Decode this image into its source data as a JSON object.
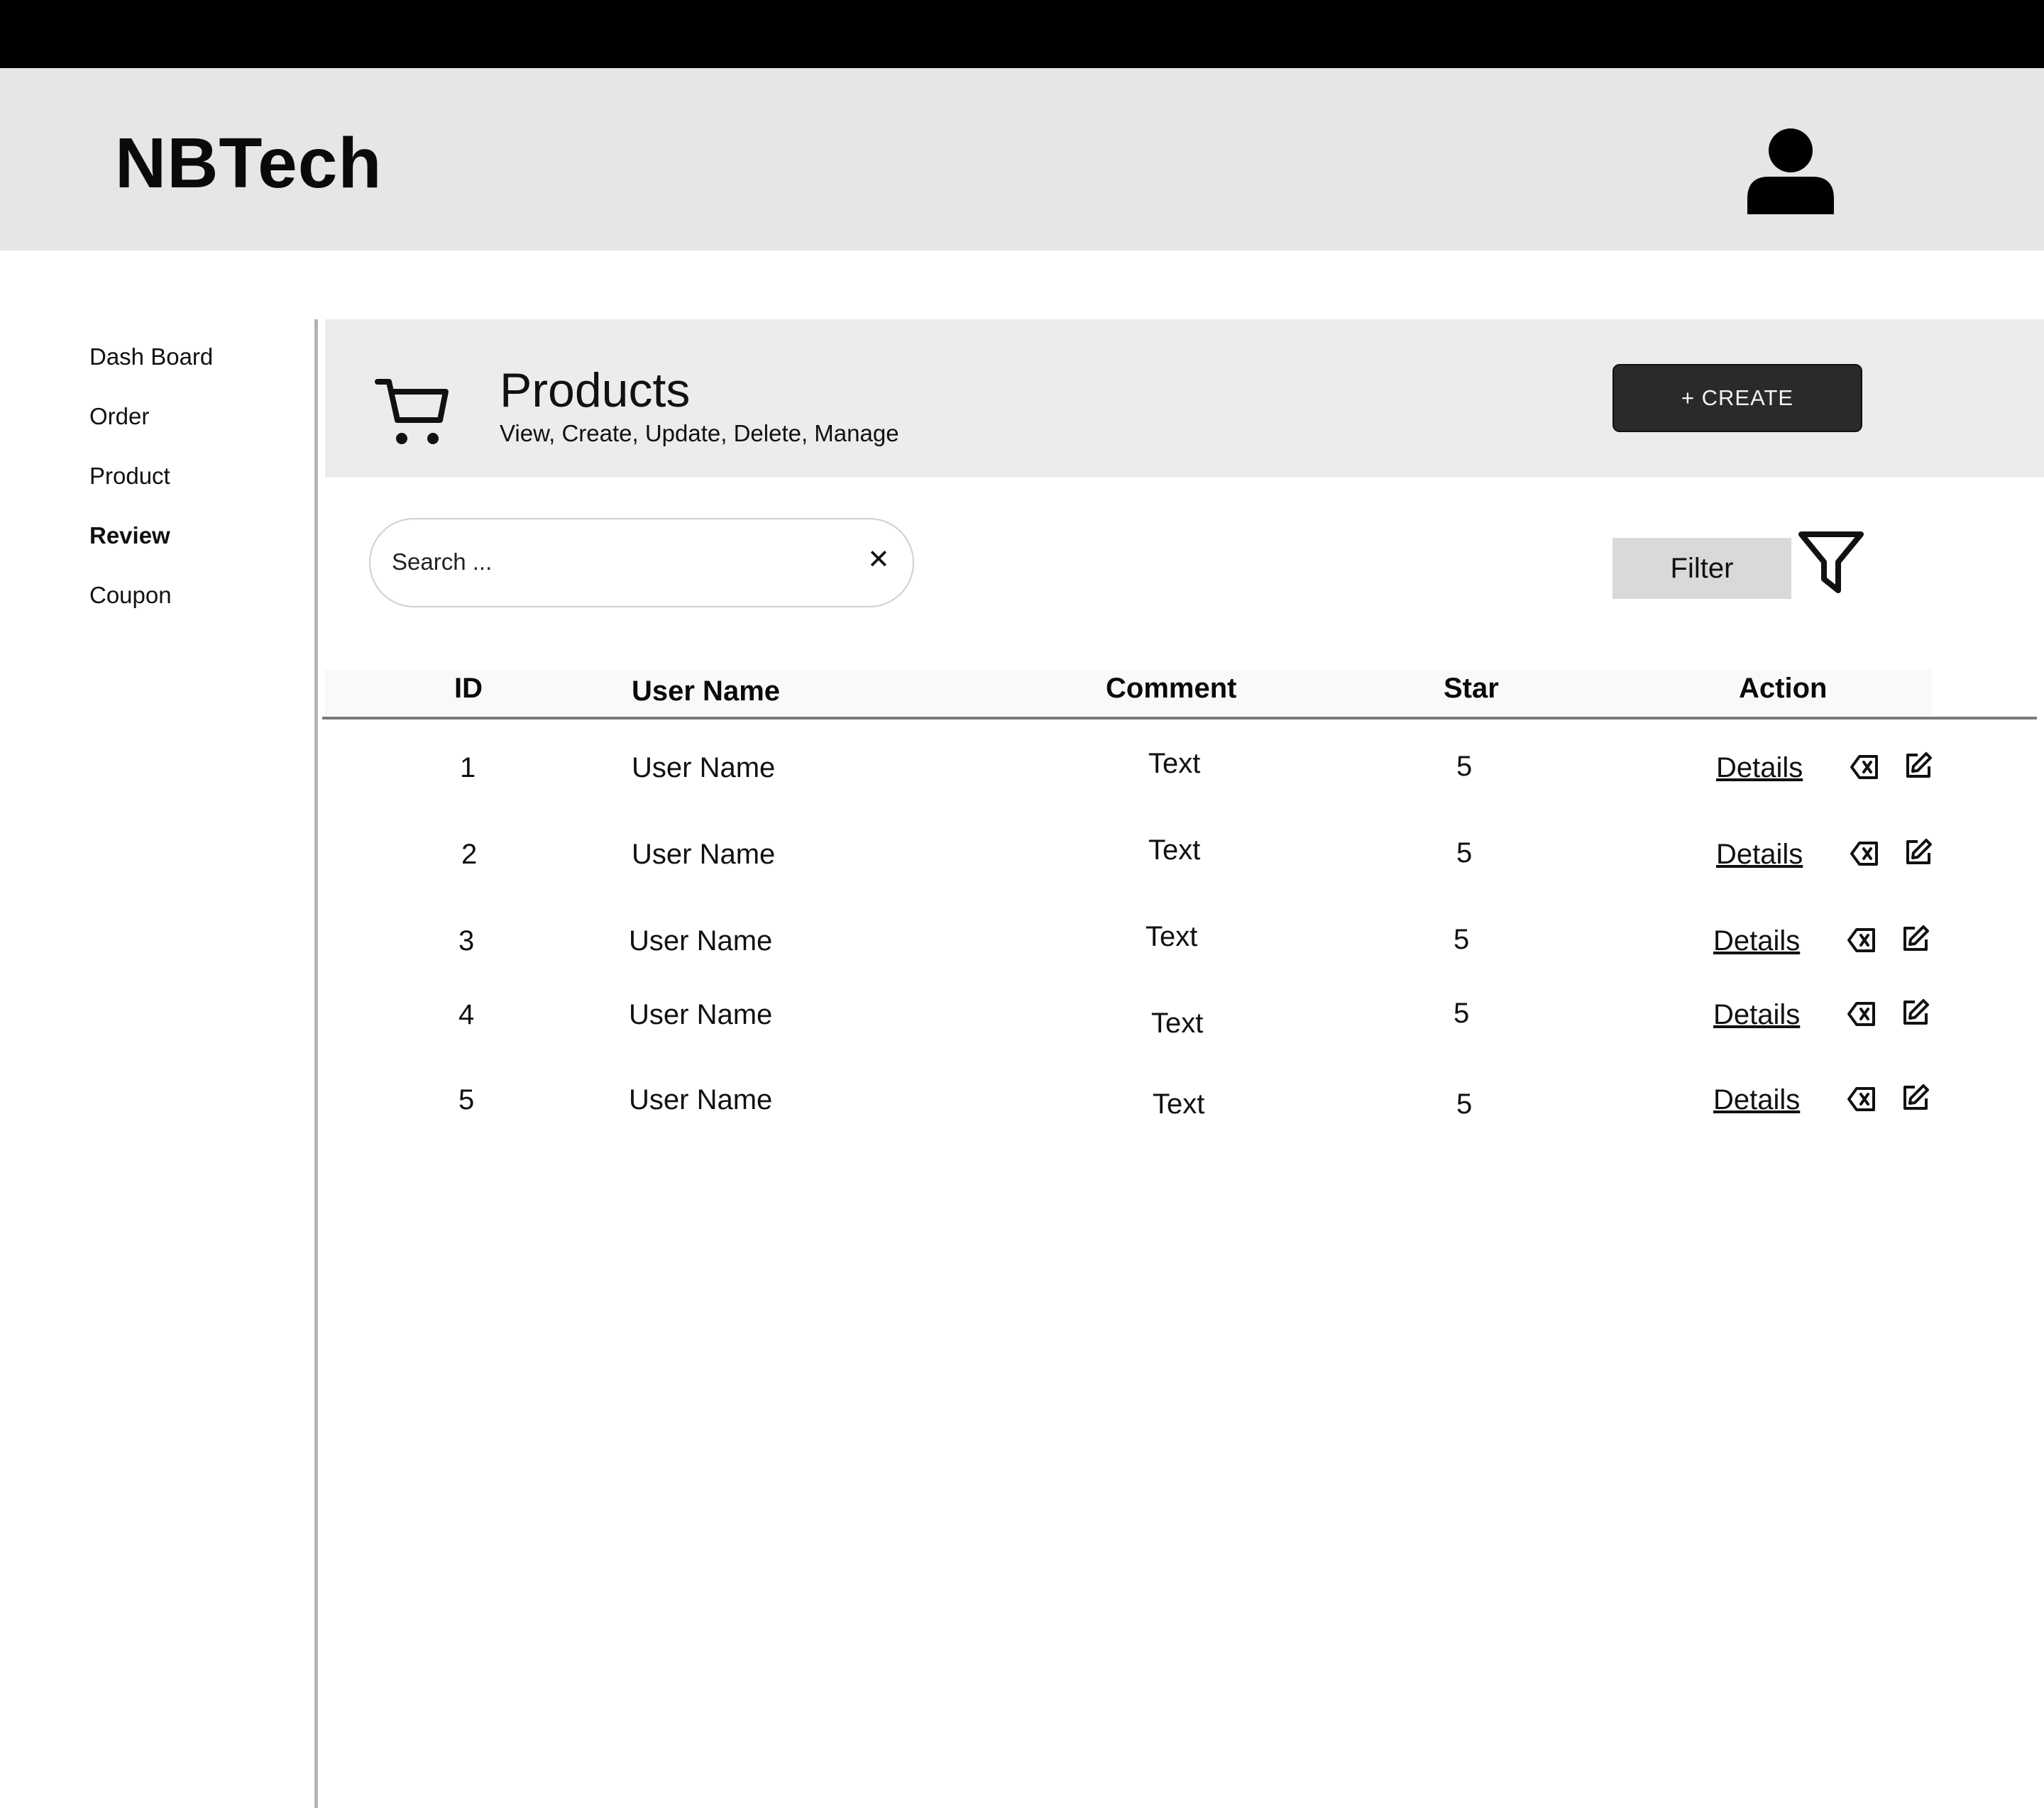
{
  "brand": "NBTech",
  "nav": [
    {
      "label": "Dash Board",
      "active": false
    },
    {
      "label": "Order",
      "active": false
    },
    {
      "label": "Product",
      "active": false
    },
    {
      "label": "Review",
      "active": true
    },
    {
      "label": "Coupon",
      "active": false
    }
  ],
  "page": {
    "title": "Products",
    "subtitle": "View, Create, Update, Delete, Manage",
    "create_label": "+ CREATE",
    "icon": "shopping-cart-icon"
  },
  "search": {
    "placeholder": "Search ...",
    "clear_glyph": "✕"
  },
  "filter": {
    "label": "Filter",
    "icon": "funnel-icon"
  },
  "table": {
    "columns": [
      "ID",
      "User Name",
      "Comment",
      "Star",
      "Action"
    ],
    "rows": [
      {
        "id": "1",
        "user": "User Name",
        "comment": "Text",
        "star": "5",
        "action": "Details"
      },
      {
        "id": "2",
        "user": "User Name",
        "comment": "Text",
        "star": "5",
        "action": "Details"
      },
      {
        "id": "3",
        "user": "User Name",
        "comment": "Text",
        "star": "5",
        "action": "Details"
      },
      {
        "id": "4",
        "user": "User Name",
        "comment": "Text",
        "star": "5",
        "action": "Details"
      },
      {
        "id": "5",
        "user": "User Name",
        "comment": "Text",
        "star": "5",
        "action": "Details"
      }
    ],
    "row_icons": [
      "delete-icon",
      "edit-icon"
    ]
  },
  "colors": {
    "topbar": "#000000",
    "header_bg": "#e6e6e6",
    "panel_bg": "#ececec",
    "create_bg": "#2a2a2a",
    "filter_bg": "#d9d9d9"
  },
  "header_icon": "user-avatar-icon"
}
